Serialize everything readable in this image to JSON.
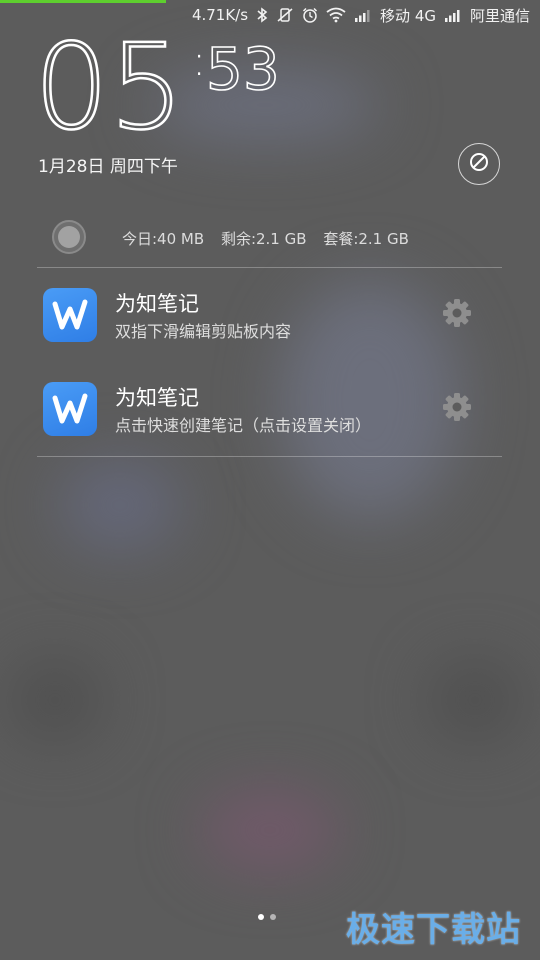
{
  "status_bar": {
    "speed": "4.71K/s",
    "carrier1": "移动 4G",
    "carrier2": "阿里通信"
  },
  "lockscreen": {
    "hours": "05",
    "minutes": "53",
    "date": "1月28日 周四下午"
  },
  "data_usage": {
    "today": "今日:40 MB",
    "remaining": "剩余:2.1 GB",
    "plan": "套餐:2.1 GB"
  },
  "notifications": [
    {
      "title": "为知笔记",
      "text": "双指下滑编辑剪贴板内容",
      "icon": "wiz-note-icon"
    },
    {
      "title": "为知笔记",
      "text": "点击快速创建笔记（点击设置关闭）",
      "icon": "wiz-note-icon"
    }
  ],
  "page_indicator": {
    "count": 2,
    "active": 1
  },
  "watermark": "极速下载站",
  "colors": {
    "accent_green": "#5ecf2f",
    "app_icon_blue": "#3d8ef0",
    "watermark_blue": "#6aaee8"
  }
}
